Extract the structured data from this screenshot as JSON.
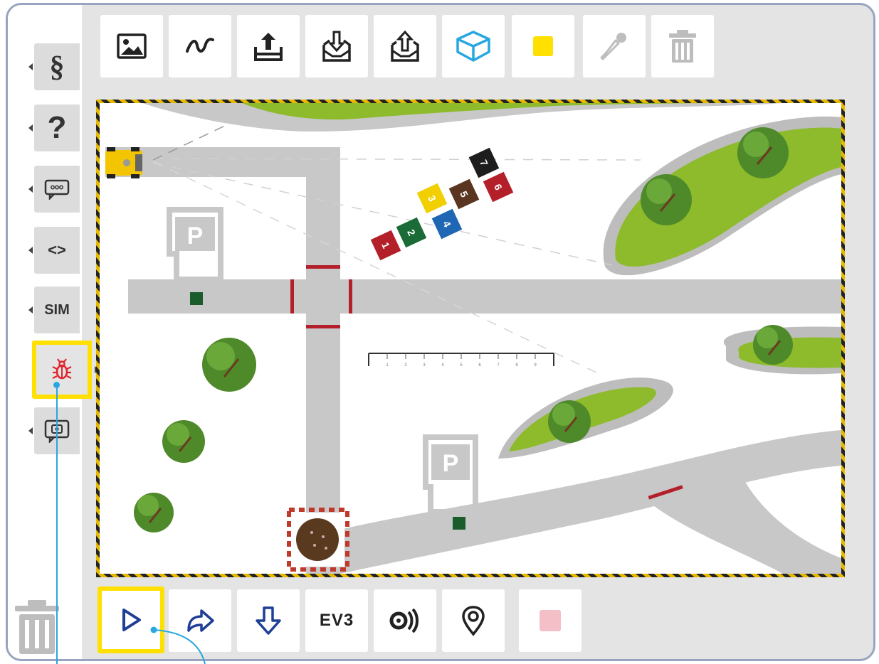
{
  "sidebar": {
    "tabs": [
      {
        "name": "paragraph",
        "label": "§"
      },
      {
        "name": "help",
        "label": "?"
      },
      {
        "name": "message",
        "label": ""
      },
      {
        "name": "code",
        "label": "<>"
      },
      {
        "name": "sim",
        "label": "SIM"
      },
      {
        "name": "debug",
        "label": ""
      },
      {
        "name": "webcam",
        "label": ""
      }
    ]
  },
  "toolbar_top": {
    "buttons": [
      "image-icon",
      "curve-icon",
      "upload-icon",
      "import-icon",
      "export-icon",
      "cube-icon",
      "color-square-icon",
      "eyedropper-icon",
      "trash-icon"
    ],
    "accent_yellow": "#ffe000",
    "accent_blue": "#29a7e0"
  },
  "toolbar_bottom": {
    "ev3_label": "EV3",
    "buttons": [
      "play-icon",
      "step-icon",
      "download-icon",
      "ev3-icon",
      "sound-icon",
      "location-pin-icon",
      "stop-icon"
    ]
  },
  "scene": {
    "parking_label": "P",
    "ruler_ticks": [
      "1",
      "2",
      "3",
      "4",
      "5",
      "6",
      "7",
      "8",
      "9"
    ],
    "color_tiles": [
      {
        "num": "1",
        "color": "#b3202a"
      },
      {
        "num": "2",
        "color": "#1a6b35"
      },
      {
        "num": "3",
        "color": "#f1cf00"
      },
      {
        "num": "4",
        "color": "#1f66b4"
      },
      {
        "num": "5",
        "color": "#5a3520"
      },
      {
        "num": "6",
        "color": "#b3202a"
      },
      {
        "num": "7",
        "color": "#1d1d1d"
      }
    ]
  }
}
